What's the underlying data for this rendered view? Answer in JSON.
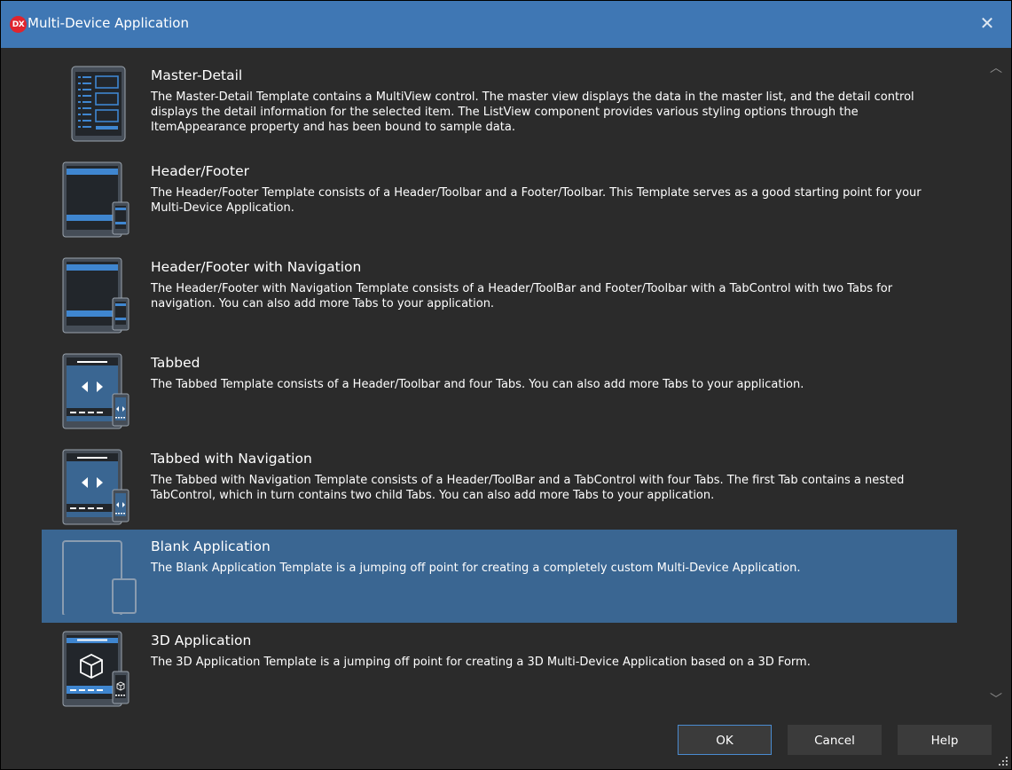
{
  "window": {
    "title": "Multi-Device Application",
    "logo_text": "DX",
    "close_glyph": "✕"
  },
  "templates": [
    {
      "name": "Master-Detail",
      "description": "The Master-Detail Template contains a MultiView control. The master view displays the data in the master list, and the detail control displays the detail information for the selected item. The ListView component provides various styling options through the ItemAppearance property and has been bound to sample data.",
      "icon": "master-detail-icon"
    },
    {
      "name": "Header/Footer",
      "description": "The Header/Footer Template consists of a Header/Toolbar and a Footer/Toolbar. This Template serves as a good starting point for your Multi-Device Application.",
      "icon": "header-footer-icon"
    },
    {
      "name": "Header/Footer with Navigation",
      "description": "The Header/Footer with Navigation Template consists of a Header/ToolBar and Footer/Toolbar with a TabControl with two Tabs for navigation.  You can also add more Tabs to your application.",
      "icon": "header-footer-navigation-icon"
    },
    {
      "name": "Tabbed",
      "description": "The Tabbed Template consists of a Header/Toolbar and four Tabs.  You can also add more Tabs to your application.",
      "icon": "tabbed-icon"
    },
    {
      "name": "Tabbed with Navigation",
      "description": "The Tabbed with Navigation Template consists of a Header/ToolBar and a TabControl with four Tabs. The first Tab contains a nested TabControl, which in turn contains two child Tabs. You can also add more Tabs to your application.",
      "icon": "tabbed-navigation-icon"
    },
    {
      "name": "Blank Application",
      "description": "The Blank Application Template is a jumping off point for creating a completely custom Multi-Device Application.",
      "icon": "blank-application-icon",
      "selected": true
    },
    {
      "name": "3D Application",
      "description": "The 3D Application Template is a jumping off point for creating a 3D Multi-Device Application based on a 3D Form.",
      "icon": "3d-application-icon"
    }
  ],
  "scrollbar": {
    "up_glyph": "︿",
    "down_glyph": "﹀"
  },
  "buttons": {
    "ok": "OK",
    "cancel": "Cancel",
    "help": "Help"
  },
  "colors": {
    "titlebar": "#3f77b4",
    "background": "#2b2b2b",
    "selection": "#3a6692",
    "accent": "#4a8bd0"
  }
}
